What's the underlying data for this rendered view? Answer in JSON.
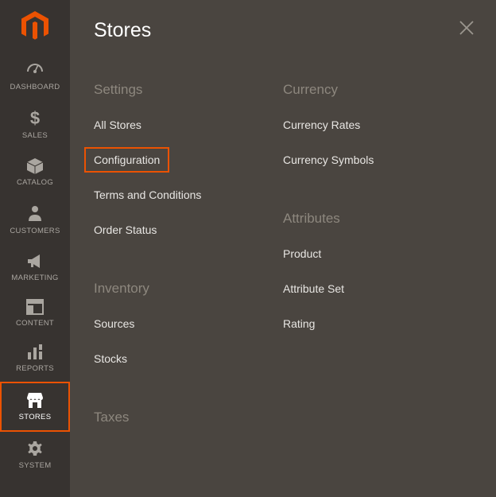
{
  "brand_color": "#eb5202",
  "sidebar": {
    "items": [
      {
        "label": "DASHBOARD",
        "name": "sidebar-item-dashboard",
        "icon": "gauge-icon",
        "active": false,
        "highlighted": false
      },
      {
        "label": "SALES",
        "name": "sidebar-item-sales",
        "icon": "dollar-icon",
        "active": false,
        "highlighted": false
      },
      {
        "label": "CATALOG",
        "name": "sidebar-item-catalog",
        "icon": "box-icon",
        "active": false,
        "highlighted": false
      },
      {
        "label": "CUSTOMERS",
        "name": "sidebar-item-customers",
        "icon": "person-icon",
        "active": false,
        "highlighted": false
      },
      {
        "label": "MARKETING",
        "name": "sidebar-item-marketing",
        "icon": "megaphone-icon",
        "active": false,
        "highlighted": false
      },
      {
        "label": "CONTENT",
        "name": "sidebar-item-content",
        "icon": "layout-icon",
        "active": false,
        "highlighted": false
      },
      {
        "label": "REPORTS",
        "name": "sidebar-item-reports",
        "icon": "barchart-icon",
        "active": false,
        "highlighted": false
      },
      {
        "label": "STORES",
        "name": "sidebar-item-stores",
        "icon": "storefront-icon",
        "active": true,
        "highlighted": true
      },
      {
        "label": "SYSTEM",
        "name": "sidebar-item-system",
        "icon": "gear-icon",
        "active": false,
        "highlighted": false
      }
    ]
  },
  "panel": {
    "title": "Stores",
    "columns": [
      {
        "sections": [
          {
            "heading": "Settings",
            "items": [
              {
                "label": "All Stores",
                "name": "menu-all-stores",
                "highlighted": false
              },
              {
                "label": "Configuration",
                "name": "menu-configuration",
                "highlighted": true
              },
              {
                "label": "Terms and Conditions",
                "name": "menu-terms-and-conditions",
                "highlighted": false
              },
              {
                "label": "Order Status",
                "name": "menu-order-status",
                "highlighted": false
              }
            ]
          },
          {
            "heading": "Inventory",
            "items": [
              {
                "label": "Sources",
                "name": "menu-sources",
                "highlighted": false
              },
              {
                "label": "Stocks",
                "name": "menu-stocks",
                "highlighted": false
              }
            ]
          },
          {
            "heading": "Taxes",
            "items": []
          }
        ]
      },
      {
        "sections": [
          {
            "heading": "Currency",
            "items": [
              {
                "label": "Currency Rates",
                "name": "menu-currency-rates",
                "highlighted": false
              },
              {
                "label": "Currency Symbols",
                "name": "menu-currency-symbols",
                "highlighted": false
              }
            ]
          },
          {
            "heading": "Attributes",
            "items": [
              {
                "label": "Product",
                "name": "menu-product",
                "highlighted": false
              },
              {
                "label": "Attribute Set",
                "name": "menu-attribute-set",
                "highlighted": false
              },
              {
                "label": "Rating",
                "name": "menu-rating",
                "highlighted": false
              }
            ]
          }
        ]
      }
    ]
  }
}
